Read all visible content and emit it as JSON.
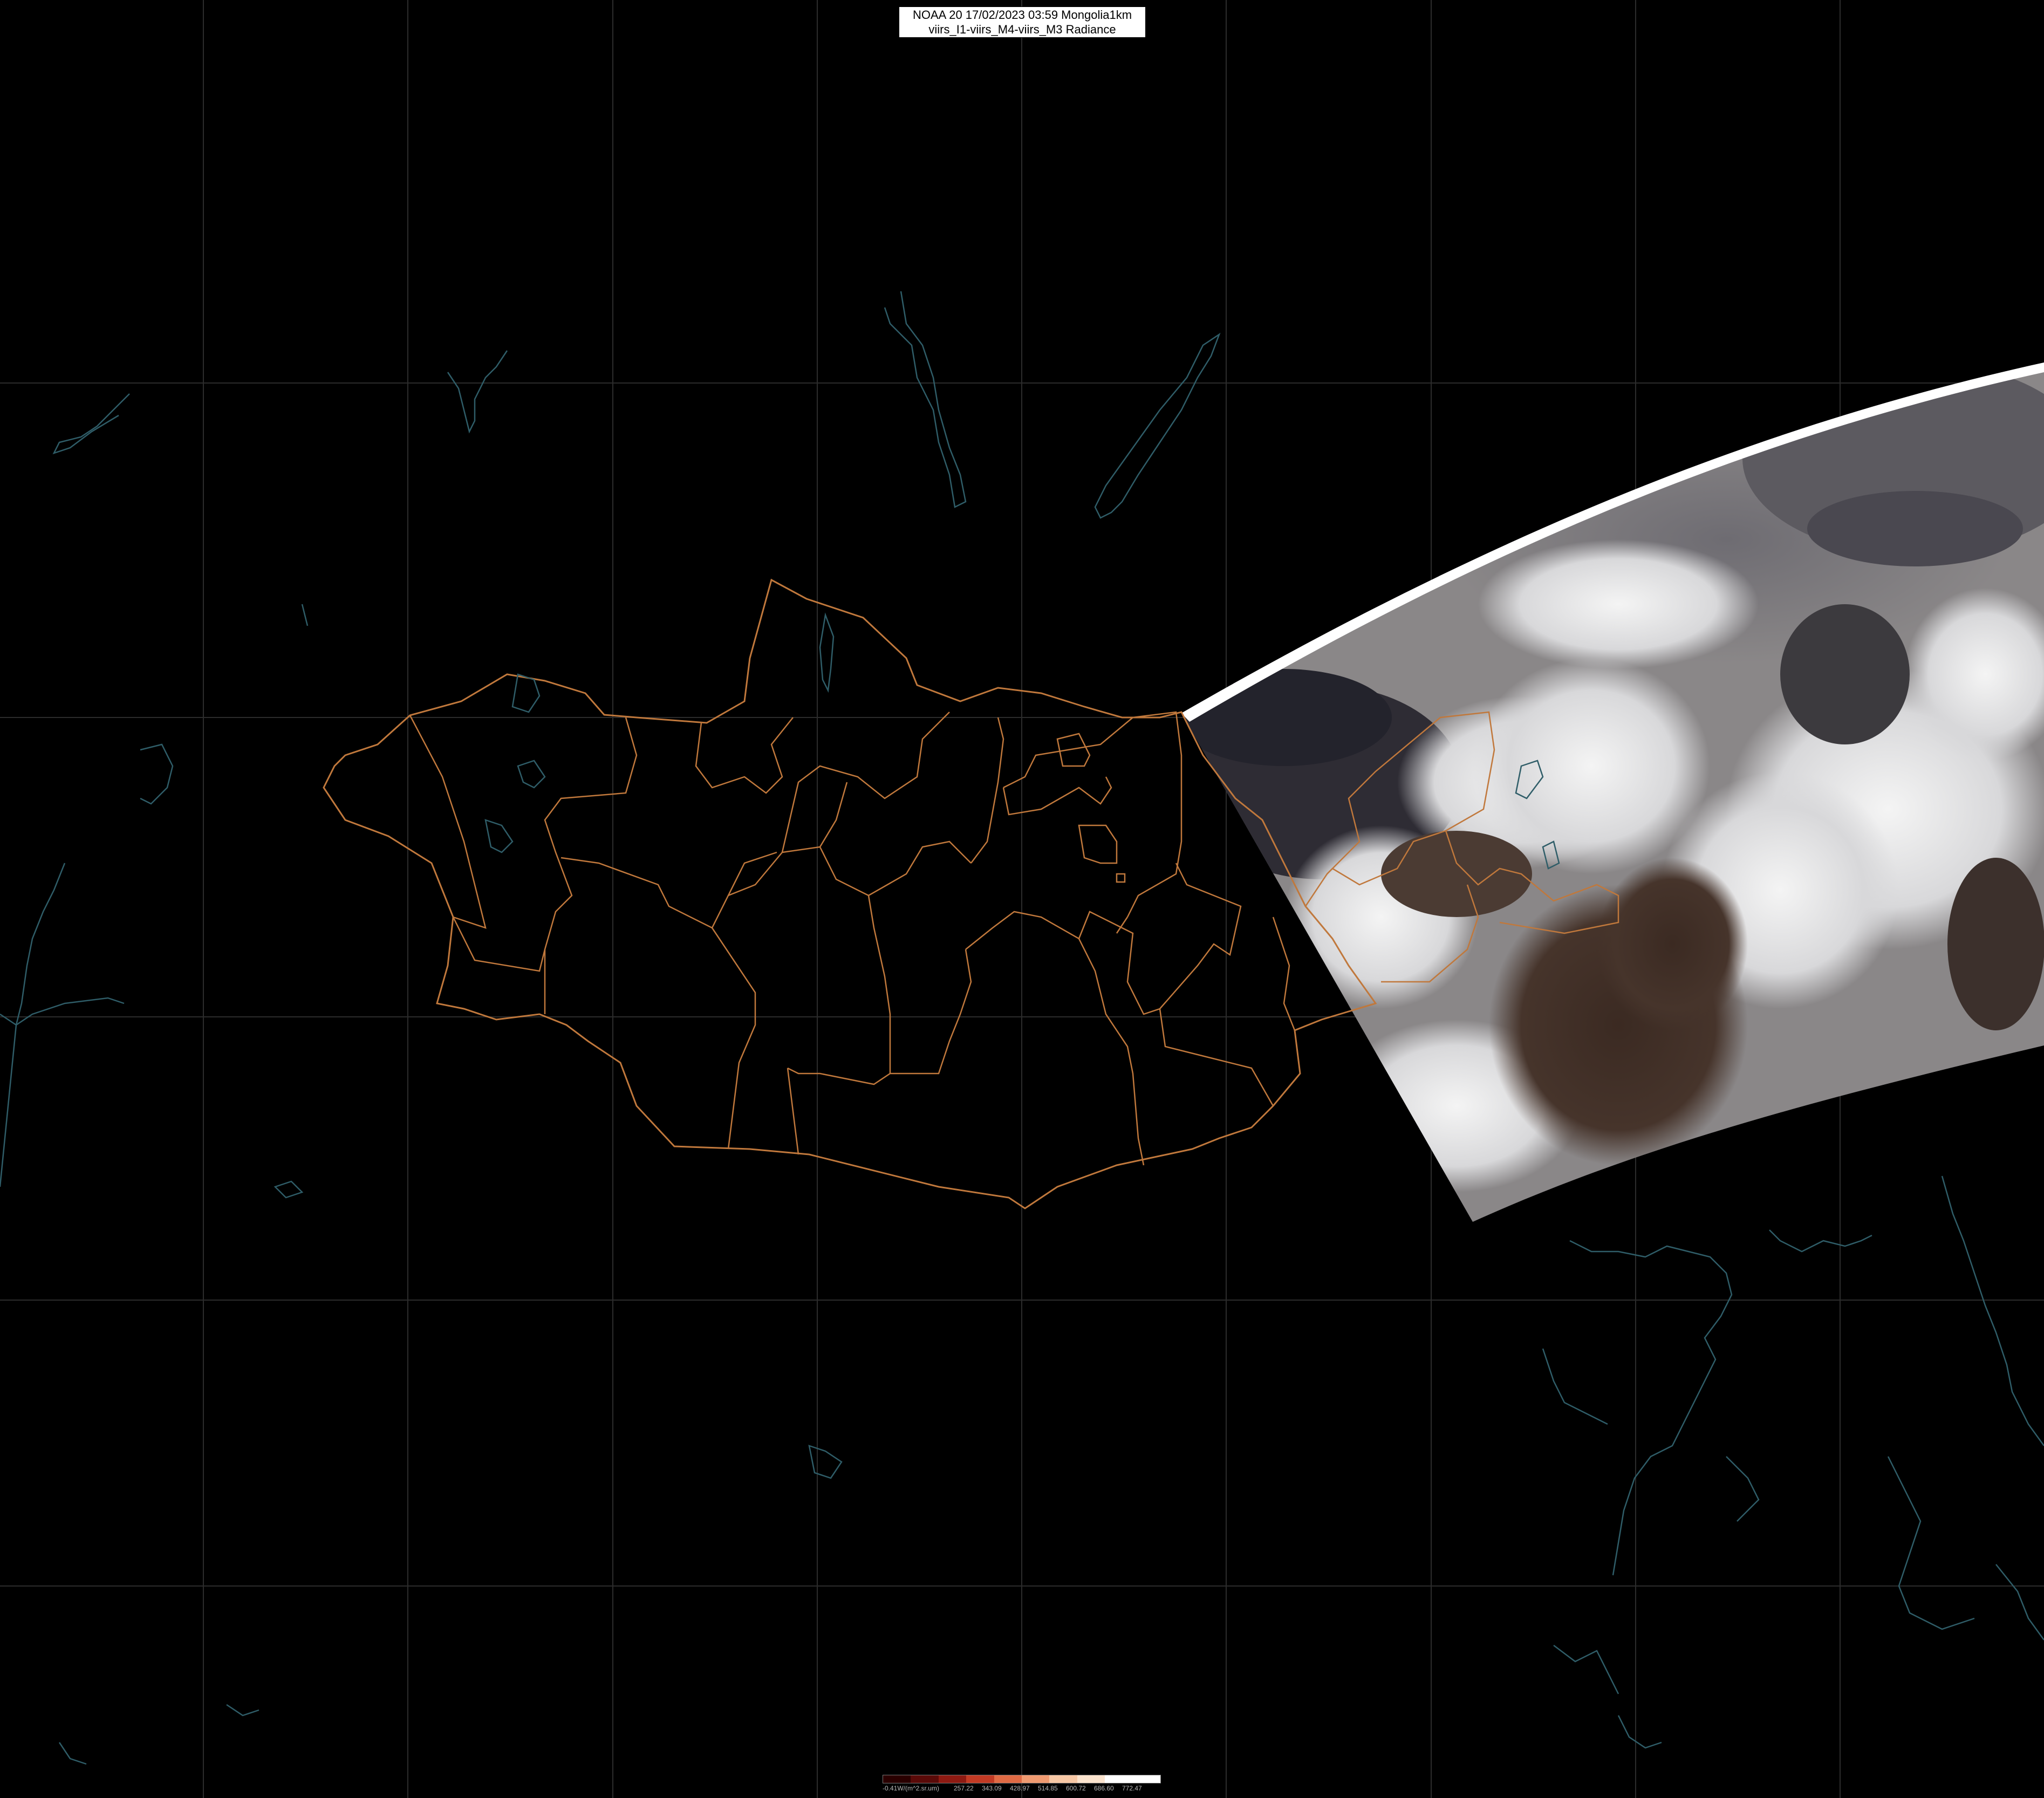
{
  "title": {
    "line1": "NOAA 20 17/02/2023 03:59 Mongolia1km",
    "line2": "viirs_I1-viirs_M4-viirs_M3 Radiance"
  },
  "legend": {
    "unit_label": "-0.41W/(m^2.sr.um)",
    "ticks": [
      "257.22",
      "343.09",
      "428.97",
      "514.85",
      "600.72",
      "686.60",
      "772.47"
    ],
    "colors": [
      "#2a0000",
      "#5a0a08",
      "#8e1a12",
      "#c23a24",
      "#e06a44",
      "#f09a70",
      "#f7c7a4",
      "#fbe3cd",
      "#ffffff",
      "#ffffff"
    ]
  },
  "colors": {
    "background": "#000000",
    "graticule": "#2e2e2e",
    "province_border": "#c0783c",
    "coastline": "#2f5d68",
    "swath_snow": "#e8e8e8",
    "swath_ground": "#3a2a22"
  },
  "map": {
    "icons": [
      "mongolia-border",
      "province-borders",
      "coastline",
      "lakes",
      "satellite-swath",
      "graticule"
    ]
  }
}
